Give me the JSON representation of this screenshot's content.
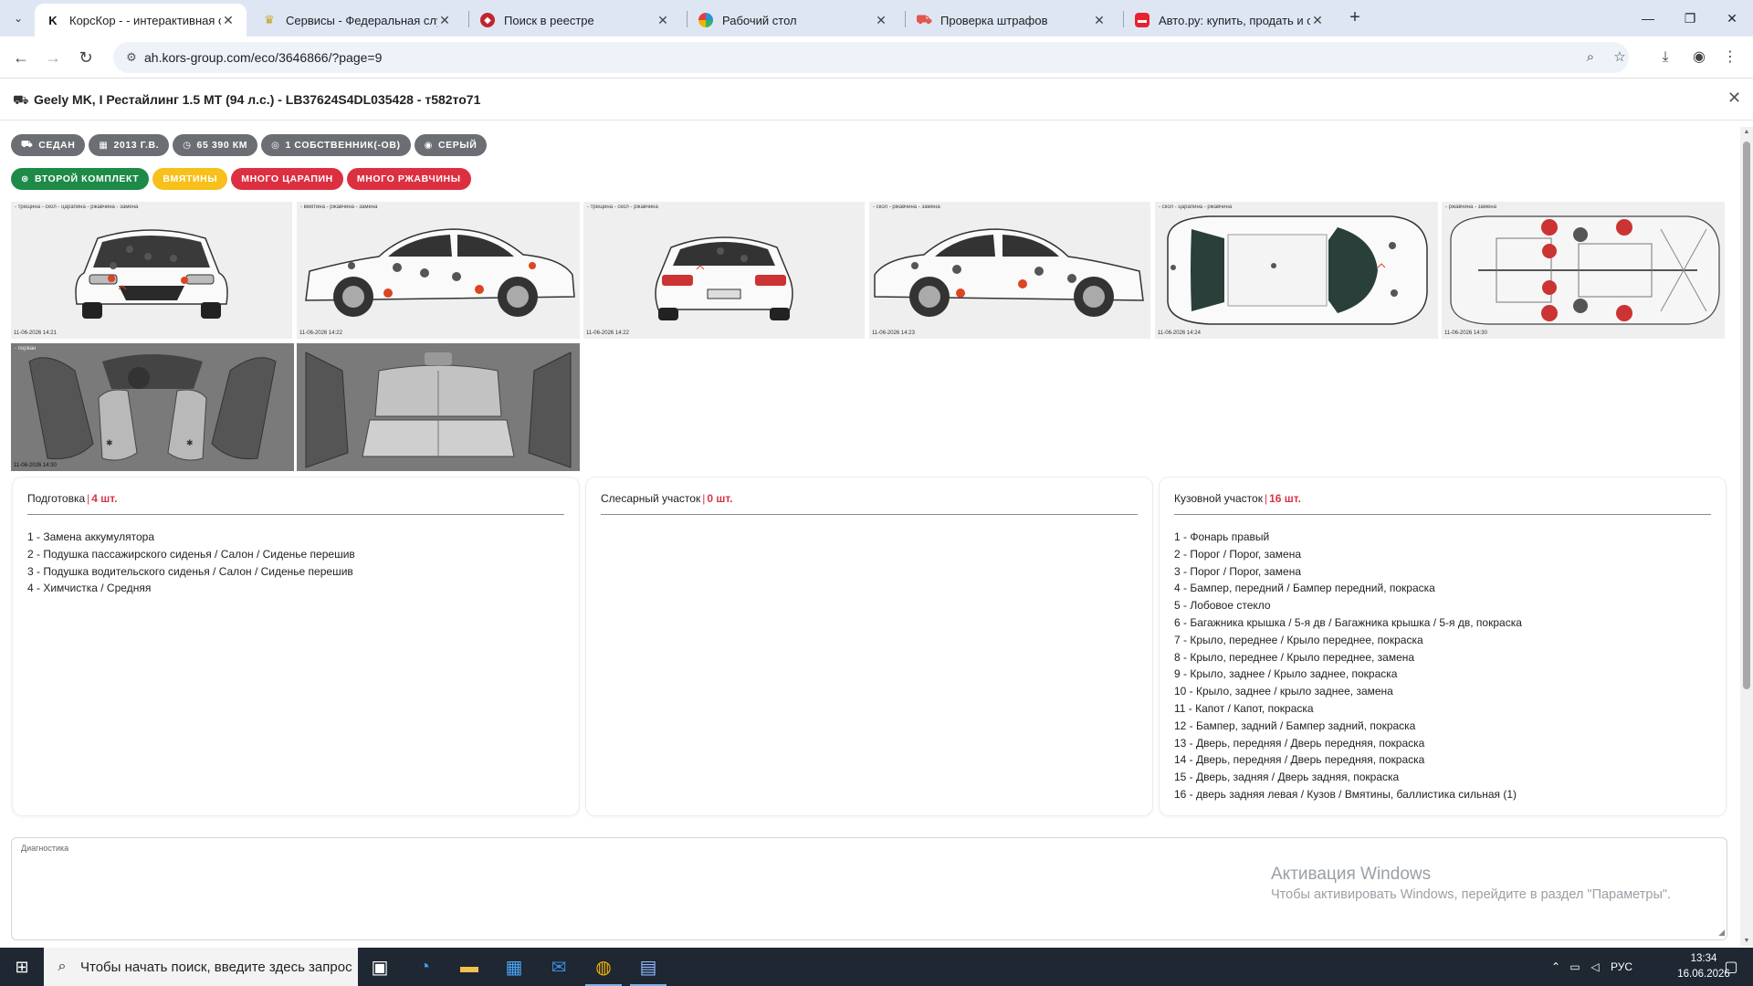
{
  "browser": {
    "tabs": [
      {
        "title": "КорсКор - - интерактивная оц",
        "favicon": "K",
        "color": "#1a1a1a",
        "active": true
      },
      {
        "title": "Сервисы - Федеральная служб",
        "favicon": "♛",
        "color": "#c9a227",
        "active": false
      },
      {
        "title": "Поиск в реестре",
        "favicon": "⛨",
        "color": "#c0262d",
        "active": false
      },
      {
        "title": "Рабочий стол",
        "favicon": "◉",
        "color": "#2f8fd8",
        "active": false
      },
      {
        "title": "Проверка штрафов",
        "favicon": "▭",
        "color": "#e2574c",
        "active": false
      },
      {
        "title": "Авто.ру: купить, продать и обм",
        "favicon": "▬",
        "color": "#e8222d",
        "active": false
      }
    ],
    "url": "ah.kors-group.com/eco/3646866/?page=9"
  },
  "vehicle": {
    "title": "Geely MK, I Рестайлинг 1.5 MT (94 л.с.) - LB37624S4DL035428 - т582то71",
    "specs": [
      "СЕДАН",
      "2013 Г.В.",
      "65 390 КМ",
      "1 СОБСТВЕННИК(-ОВ)",
      "СЕРЫЙ"
    ],
    "tags": [
      {
        "label": "ВТОРОЙ КОМПЛЕКТ",
        "color": "green"
      },
      {
        "label": "ВМЯТИНЫ",
        "color": "yellow"
      },
      {
        "label": "МНОГО ЦАРАПИН",
        "color": "red"
      },
      {
        "label": "МНОГО РЖАВЧИНЫ",
        "color": "red"
      }
    ]
  },
  "gallery": {
    "legends": [
      "- трещина - скол - царапина - ржавчина - замена",
      "- вмятина - ржавчина - замена",
      "- трещина - скол - ржавчина",
      "- скол - ржавчина - замена",
      "- скол - царапина - ржавчина",
      "- ржавчина - замена",
      "- порван",
      ""
    ],
    "stamps": [
      "11-06-2026 14:21",
      "11-06-2026 14:22",
      "11-06-2026 14:22",
      "11-06-2026 14:23",
      "11-06-2026 14:24",
      "11-06-2026 14:30",
      "11-06-2026 14:30",
      ""
    ]
  },
  "panels": [
    {
      "name": "Подготовка",
      "count": "4 шт.",
      "items": [
        "1 - Замена аккумулятора",
        "2 - Подушка пассажирского сиденья / Салон / Сиденье перешив",
        "3 - Подушка водительского сиденья / Салон / Сиденье перешив",
        "4 - Химчистка / Средняя"
      ]
    },
    {
      "name": "Слесарный участок",
      "count": "0 шт.",
      "items": []
    },
    {
      "name": "Кузовной участок",
      "count": "16 шт.",
      "items": [
        "1 - Фонарь правый",
        "2 - Порог / Порог, замена",
        "3 - Порог / Порог, замена",
        "4 - Бампер, передний / Бампер передний, покраска",
        "5 - Лобовое стекло",
        "6 - Багажника крышка / 5-я дв / Багажника крышка / 5-я дв, покраска",
        "7 - Крыло, переднее / Крыло переднее, покраска",
        "8 - Крыло, переднее / Крыло переднее, замена",
        "9 - Крыло, заднее / Крыло заднее, покраска",
        "10 - Крыло, заднее / крыло заднее, замена",
        "11 - Капот / Капот, покраска",
        "12 - Бампер, задний / Бампер задний, покраска",
        "13 - Дверь, передняя / Дверь передняя, покраска",
        "14 - Дверь, передняя / Дверь передняя, покраска",
        "15 - Дверь, задняя / Дверь задняя, покраска",
        "16 - дверь задняя левая / Кузов / Вмятины, баллистика сильная (1)"
      ]
    }
  ],
  "diagnostics": {
    "label": "Диагностика"
  },
  "watermark": {
    "line1": "Активация Windows",
    "line2": "Чтобы активировать Windows, перейдите в раздел \"Параметры\"."
  },
  "taskbar": {
    "search_placeholder": "Чтобы начать поиск, введите здесь запрос",
    "language": "РУС",
    "time": "13:34",
    "date": "16.06.2026"
  },
  "colors": {
    "green": "#1e8a48",
    "yellow": "#f7c01a",
    "red": "#dc3041",
    "gray": "#6b6f73",
    "accent_count": "#d8334a"
  }
}
